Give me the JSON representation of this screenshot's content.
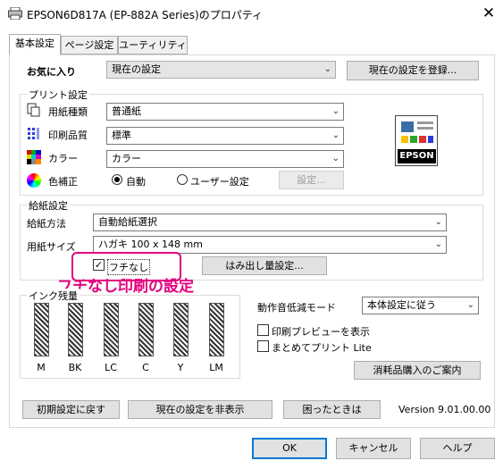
{
  "window": {
    "title": "EPSON6D817A (EP-882A Series)のプロパティ",
    "close_glyph": "✕"
  },
  "tabs": [
    "基本設定",
    "ページ設定",
    "ユーティリティー"
  ],
  "favorites": {
    "label": "お気に入り",
    "value": "現在の設定",
    "register_button": "現在の設定を登録..."
  },
  "print_settings": {
    "legend": "プリント設定",
    "paper_type": {
      "label": "用紙種類",
      "value": "普通紙"
    },
    "quality": {
      "label": "印刷品質",
      "value": "標準"
    },
    "color": {
      "label": "カラー",
      "value": "カラー"
    },
    "color_correction": {
      "label": "色補正",
      "auto": "自動",
      "user": "ユーザー設定",
      "settings_button": "設定..."
    }
  },
  "printer_logo": "EPSON",
  "paper_feed": {
    "legend": "給紙設定",
    "source": {
      "label": "給紙方法",
      "value": "自動給紙選択"
    },
    "size": {
      "label": "用紙サイズ",
      "value": "ハガキ 100 x 148 mm"
    },
    "borderless": {
      "label": "フチなし",
      "checked": true
    },
    "expansion_button": "はみ出し量設定..."
  },
  "annotation": "フチなし印刷の設定",
  "ink": {
    "legend": "インク残量",
    "colors": [
      "M",
      "BK",
      "LC",
      "C",
      "Y",
      "LM"
    ]
  },
  "quiet_mode": {
    "label": "動作音低減モード",
    "value": "本体設定に従う"
  },
  "options": {
    "preview": {
      "label": "印刷プレビューを表示",
      "checked": false
    },
    "batch": {
      "label": "まとめてプリント Lite",
      "checked": false
    }
  },
  "supplies_button": "消耗品購入のご案内",
  "bottom_buttons": {
    "reset": "初期設定に戻す",
    "hide": "現在の設定を非表示",
    "help_trouble": "困ったときは"
  },
  "version": "Version 9.01.00.00",
  "dialog_buttons": {
    "ok": "OK",
    "cancel": "キャンセル",
    "help": "ヘルプ"
  },
  "accent_colors": {
    "highlight": "#e3007e",
    "focus": "#0078d7"
  }
}
